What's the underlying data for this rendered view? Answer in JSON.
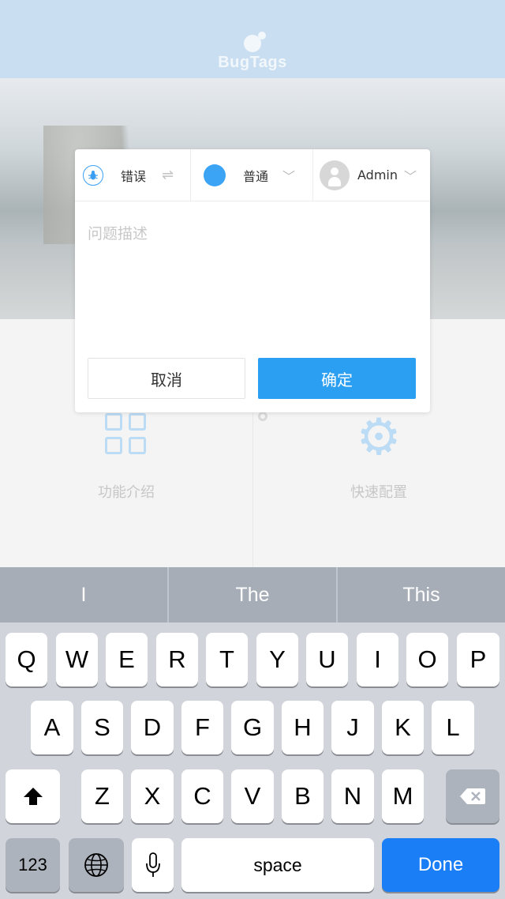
{
  "header": {
    "logo_text": "BugTags"
  },
  "background": {
    "feature_intro_label": "功能介绍",
    "quick_config_label": "快速配置"
  },
  "dialog": {
    "type_label": "错误",
    "priority_label": "普通",
    "priority_color": "#3ba4f5",
    "assignee_label": "Admin",
    "description_placeholder": "问题描述",
    "description_value": "",
    "cancel_label": "取消",
    "confirm_label": "确定",
    "accent_color": "#2b9ff2"
  },
  "keyboard": {
    "suggestions": [
      "I",
      "The",
      "This"
    ],
    "row1": [
      "Q",
      "W",
      "E",
      "R",
      "T",
      "Y",
      "U",
      "I",
      "O",
      "P"
    ],
    "row2": [
      "A",
      "S",
      "D",
      "F",
      "G",
      "H",
      "J",
      "K",
      "L"
    ],
    "row3": [
      "Z",
      "X",
      "C",
      "V",
      "B",
      "N",
      "M"
    ],
    "numbers_label": "123",
    "space_label": "space",
    "done_label": "Done",
    "done_color": "#1a7ef7"
  }
}
